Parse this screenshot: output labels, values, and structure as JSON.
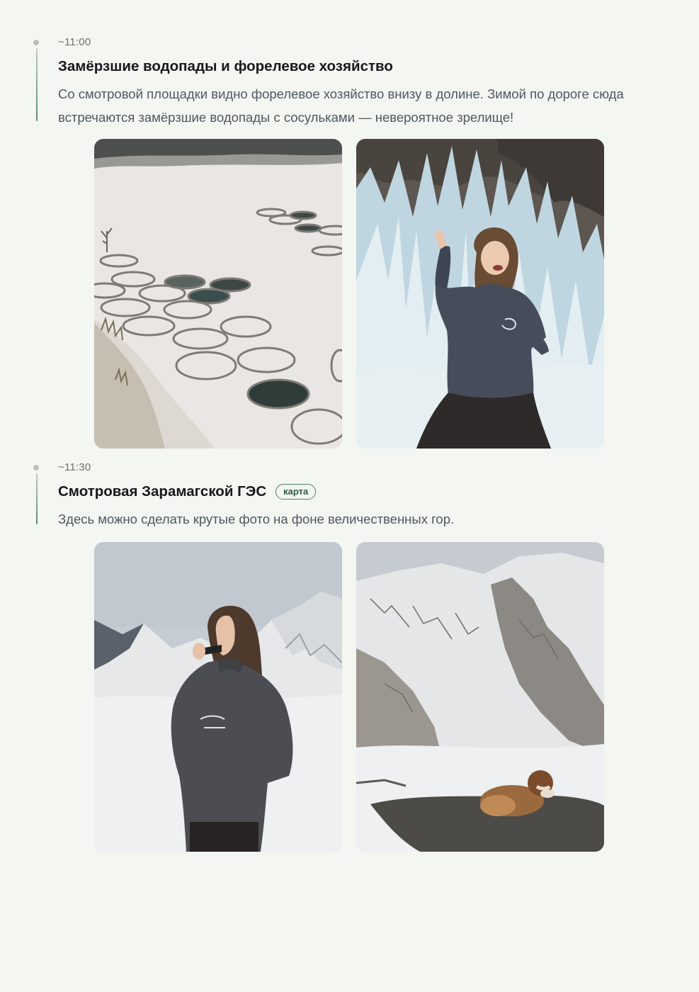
{
  "entries": [
    {
      "time": "~11:00",
      "title": "Замёрзшие водопады и форелевое хозяйство",
      "description": "Со смотровой площадки видно форелевое хозяйство внизу в долине. Зимой по дороге сюда встречаются замёрзшие водопады с сосульками — невероятное зрелище!",
      "photos": [
        {
          "name": "trout-farm-photo"
        },
        {
          "name": "frozen-waterfall-photo"
        }
      ]
    },
    {
      "time": "~11:30",
      "title": "Смотровая Зарамагской ГЭС",
      "badge": "карта",
      "description": "Здесь можно сделать крутые фото на фоне величественных гор.",
      "photos": [
        {
          "name": "woman-mountains-photo"
        },
        {
          "name": "dog-snow-mountain-photo"
        }
      ]
    }
  ],
  "colors": {
    "background": "#f3f6f1",
    "accent": "#4f7f68",
    "timeline_dot": "#b9c2b3",
    "description_text": "#4e5863"
  }
}
